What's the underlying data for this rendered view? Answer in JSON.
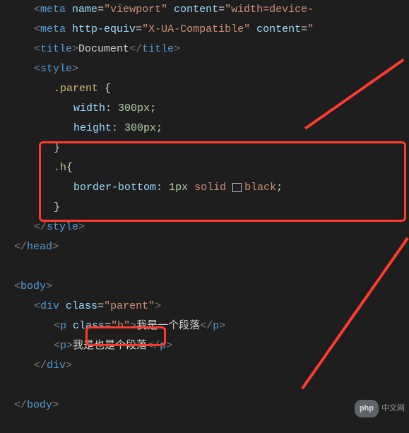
{
  "code": {
    "meta_tag": "meta",
    "meta1_attr": "name",
    "meta1_val": "\"viewport\"",
    "meta1_attr2": "content",
    "meta1_val2": "\"width=device-",
    "meta2_attr": "http-equiv",
    "meta2_val": "\"X-UA-Compatible\"",
    "meta2_attr2": "content",
    "title_tag": "title",
    "title_text": "Document",
    "style_tag": "style",
    "selector_parent": ".parent",
    "prop_width": "width",
    "val_width_num": "300px",
    "prop_height": "height",
    "val_height_num": "300px",
    "selector_h": ".h",
    "prop_border": "border-bottom",
    "val_border_1px": "1px",
    "val_border_solid": "solid",
    "val_border_black": "black",
    "head_tag": "head",
    "body_tag": "body",
    "div_tag": "div",
    "p_tag": "p",
    "class_attr": "class",
    "class_parent_val": "\"parent\"",
    "class_h_val": "\"h\"",
    "p1_text": "我是一个段落",
    "p2_text": "我是也是个段落",
    "open_brace": " {",
    "close_brace": "}",
    "lt": "<",
    "gt": ">",
    "ltslash": "</",
    "eq": "=",
    "colon": ":",
    "semicolon": ";",
    "space": " "
  },
  "watermark": {
    "badge": "php",
    "site": "中文网"
  }
}
